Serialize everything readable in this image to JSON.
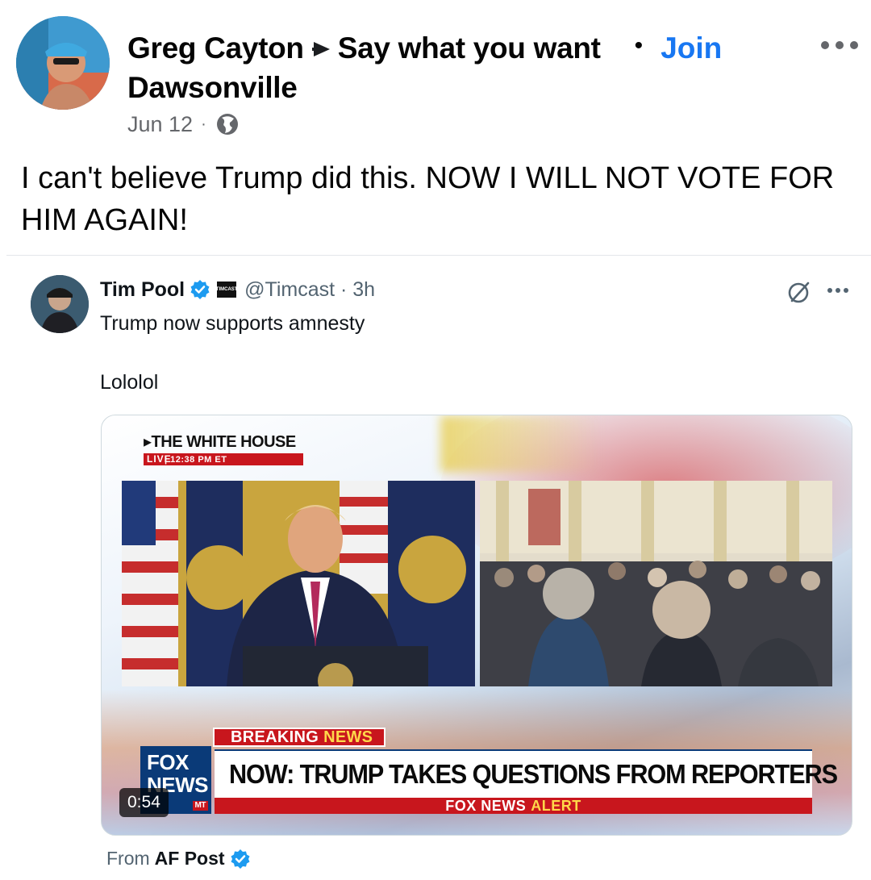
{
  "post": {
    "author": "Greg Cayton",
    "group_name": "Say what you want",
    "group_name_line2": "Dawsonville",
    "separator": "•",
    "join_label": "Join",
    "date": "Jun 12",
    "meta_dot": "·",
    "privacy_icon": "globe-icon",
    "more_icon": "more-options-icon",
    "text": "I can't believe Trump did this. NOW I WILL NOT VOTE FOR HIM AGAIN!"
  },
  "tweet": {
    "author": "Tim Pool",
    "handle_time": "@Timcast · 3h",
    "org_badge": "TIMCAST",
    "text_line1": "Trump now supports amnesty",
    "text_line2": "Lololol",
    "media": {
      "wh_label": "▸THE WHITE HOUSE",
      "live_label": "LIVE",
      "live_time": "| 12:38 PM ET",
      "breaking_1": "BREAKING",
      "breaking_2": "NEWS",
      "headline": "NOW: TRUMP TAKES QUESTIONS FROM REPORTERS",
      "alert_1": "FOX NEWS",
      "alert_2": "ALERT",
      "logo_line1": "FOX",
      "logo_line2": "NEWS",
      "logo_tag": "MT",
      "duration": "0:54"
    },
    "from_label": "From",
    "from_source": "AF Post"
  },
  "colors": {
    "link_blue": "#1877f2",
    "verified_blue": "#1d9bf0",
    "fox_red": "#c8161d",
    "fox_navy": "#0a3a78"
  }
}
